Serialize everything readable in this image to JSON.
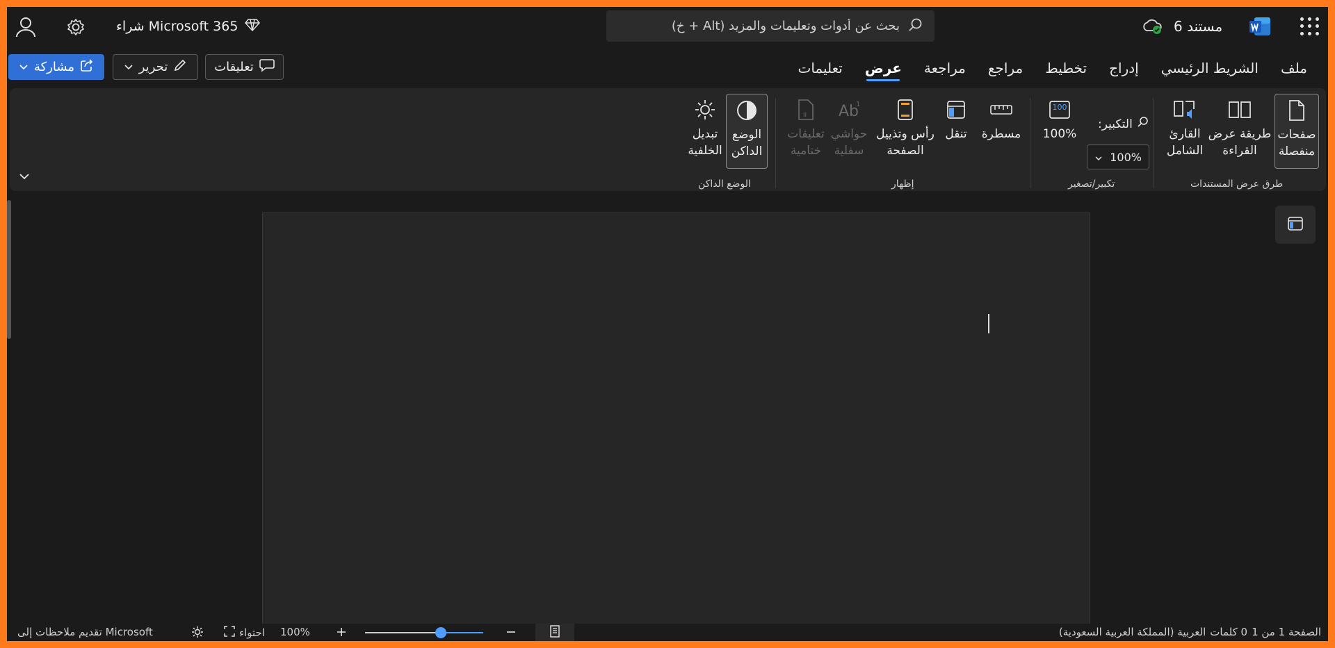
{
  "titlebar": {
    "app_launcher_icon": "waffle-icon",
    "app_icon": "word-icon",
    "doc_name": "مستند 6",
    "cloud_status_icon": "cloud-check-icon",
    "search_placeholder": "بحث عن أدوات وتعليمات والمزيد (Alt + خ)",
    "buy_label": "شراء Microsoft 365",
    "premium_icon": "diamond-icon",
    "settings_icon": "gear-icon",
    "account_icon": "person-icon"
  },
  "tabs": [
    {
      "label": "ملف"
    },
    {
      "label": "الشريط الرئيسي"
    },
    {
      "label": "إدراج"
    },
    {
      "label": "تخطيط"
    },
    {
      "label": "مراجع"
    },
    {
      "label": "مراجعة"
    },
    {
      "label": "عرض",
      "active": true
    },
    {
      "label": "تعليمات"
    }
  ],
  "actions": {
    "comments": "تعليقات",
    "edit": "تحرير",
    "share": "مشاركة"
  },
  "ribbon": {
    "doc_views": {
      "label": "طرق عرض المستندات",
      "pages": "صفحات منفصلة",
      "reading": "طريقة عرض القراءة",
      "immersive": "القارئ الشامل"
    },
    "zoom": {
      "label": "تكبير/تصغير",
      "zoom_label": "التكبير:",
      "zoom_value": "100%",
      "zoom100": "100%"
    },
    "show": {
      "label": "إظهار",
      "ruler": "مسطرة",
      "navigation": "تنقل",
      "header_footer": "رأس وتذييل الصفحة",
      "footnotes": "حواشي سفلية",
      "endnotes": "تعليقات ختامية"
    },
    "dark_mode": {
      "label": "الوضع الداكن",
      "dark_mode": "الوضع الداكن",
      "switch_bg": "تبديل الخلفية"
    }
  },
  "status": {
    "page": "الصفحة 1 من 1",
    "words": "0 كلمات",
    "language": "العربية (المملكة العربية السعودية)",
    "zoom": "100%",
    "fit": "احتواء",
    "feedback": "تقديم ملاحظات إلى Microsoft",
    "zoom_fraction": 0.64
  },
  "colors": {
    "accent": "#4f9dff",
    "share": "#2f6fd6",
    "border": "#ff7a1a"
  }
}
